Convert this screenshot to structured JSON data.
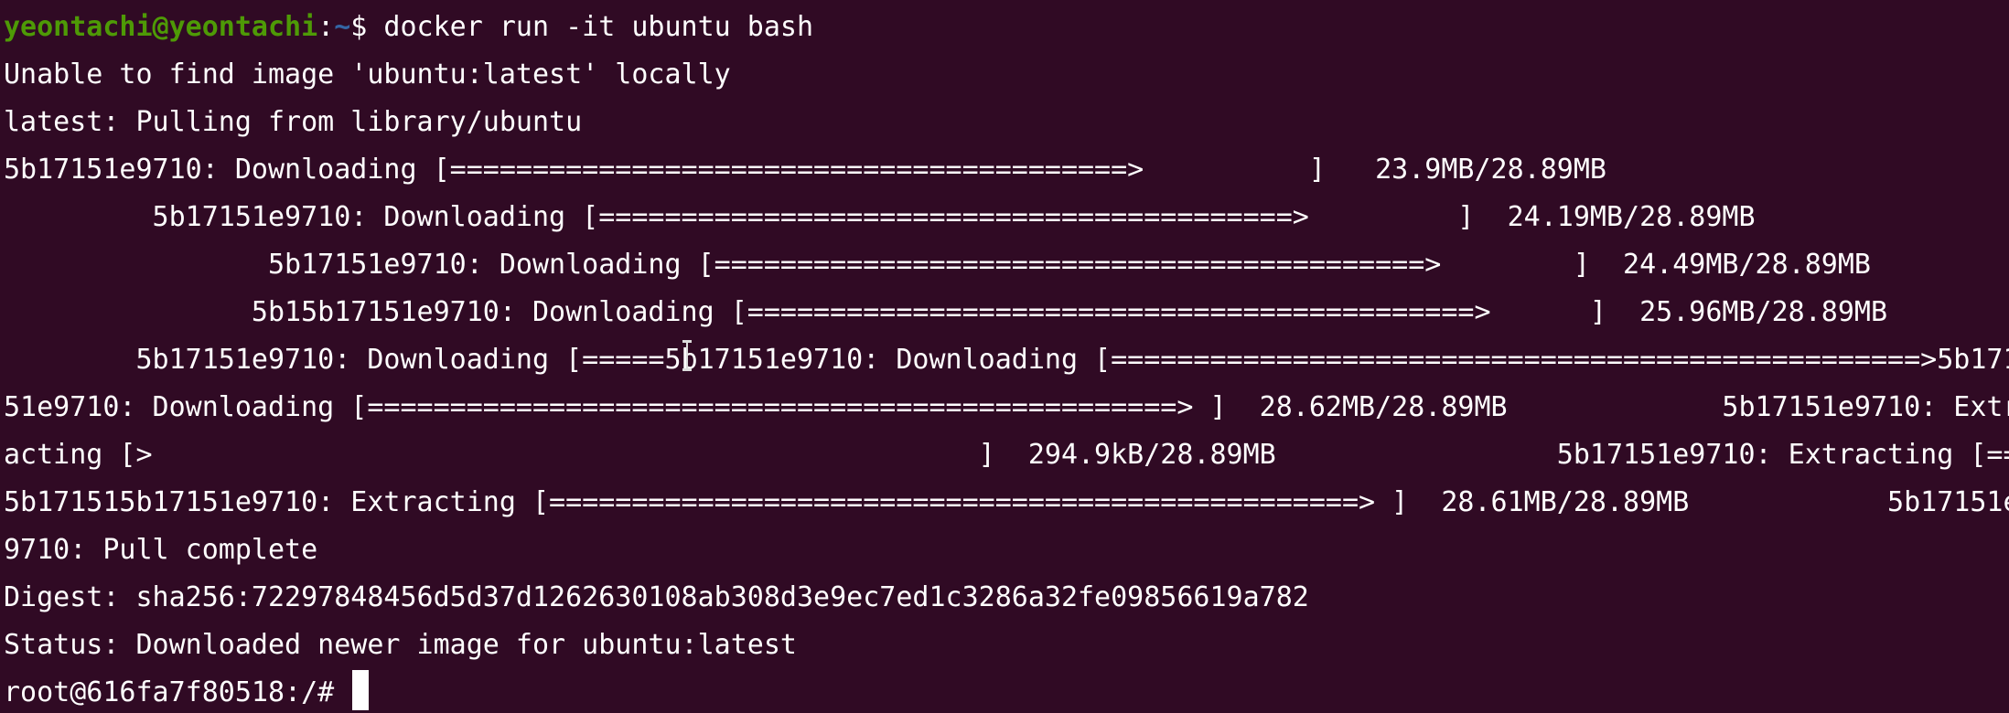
{
  "prompt": {
    "user_host": "yeontachi@yeontachi",
    "colon": ":",
    "path": "~",
    "symbol": "$ ",
    "command": "docker run -it ubuntu bash"
  },
  "output_lines": [
    "Unable to find image 'ubuntu:latest' locally",
    "latest: Pulling from library/ubuntu",
    "5b17151e9710: Downloading [=========================================>          ]   23.9MB/28.89MB",
    "         5b17151e9710: Downloading [==========================================>         ]  24.19MB/28.89MB",
    "                5b17151e9710: Downloading [===========================================>        ]  24.49MB/28.89MB",
    "               5b15b17151e9710: Downloading [============================================>      ]  25.96MB/28.89MB",
    "        5b17151e9710: Downloading [=====5b17151e9710: Downloading [=================================================>5b171",
    "51e9710: Downloading [=================================================> ]  28.62MB/28.89MB             5b17151e9710: Extr",
    "acting [>                                                  ]  294.9kB/28.89MB                 5b17151e9710: Extracting [==",
    "5b171515b17151e9710: Extracting [=================================================> ]  28.61MB/28.89MB            5b17151e",
    "9710: Pull complete",
    "Digest: sha256:72297848456d5d37d1262630108ab308d3e9ec7ed1c3286a32fe09856619a782",
    "Status: Downloaded newer image for ubuntu:latest"
  ],
  "container_prompt": "root@616fa7f80518:/# ",
  "colors": {
    "background": "#300a24",
    "foreground": "#ffffff",
    "prompt_user": "#4e9a06",
    "prompt_path": "#3465a4"
  }
}
